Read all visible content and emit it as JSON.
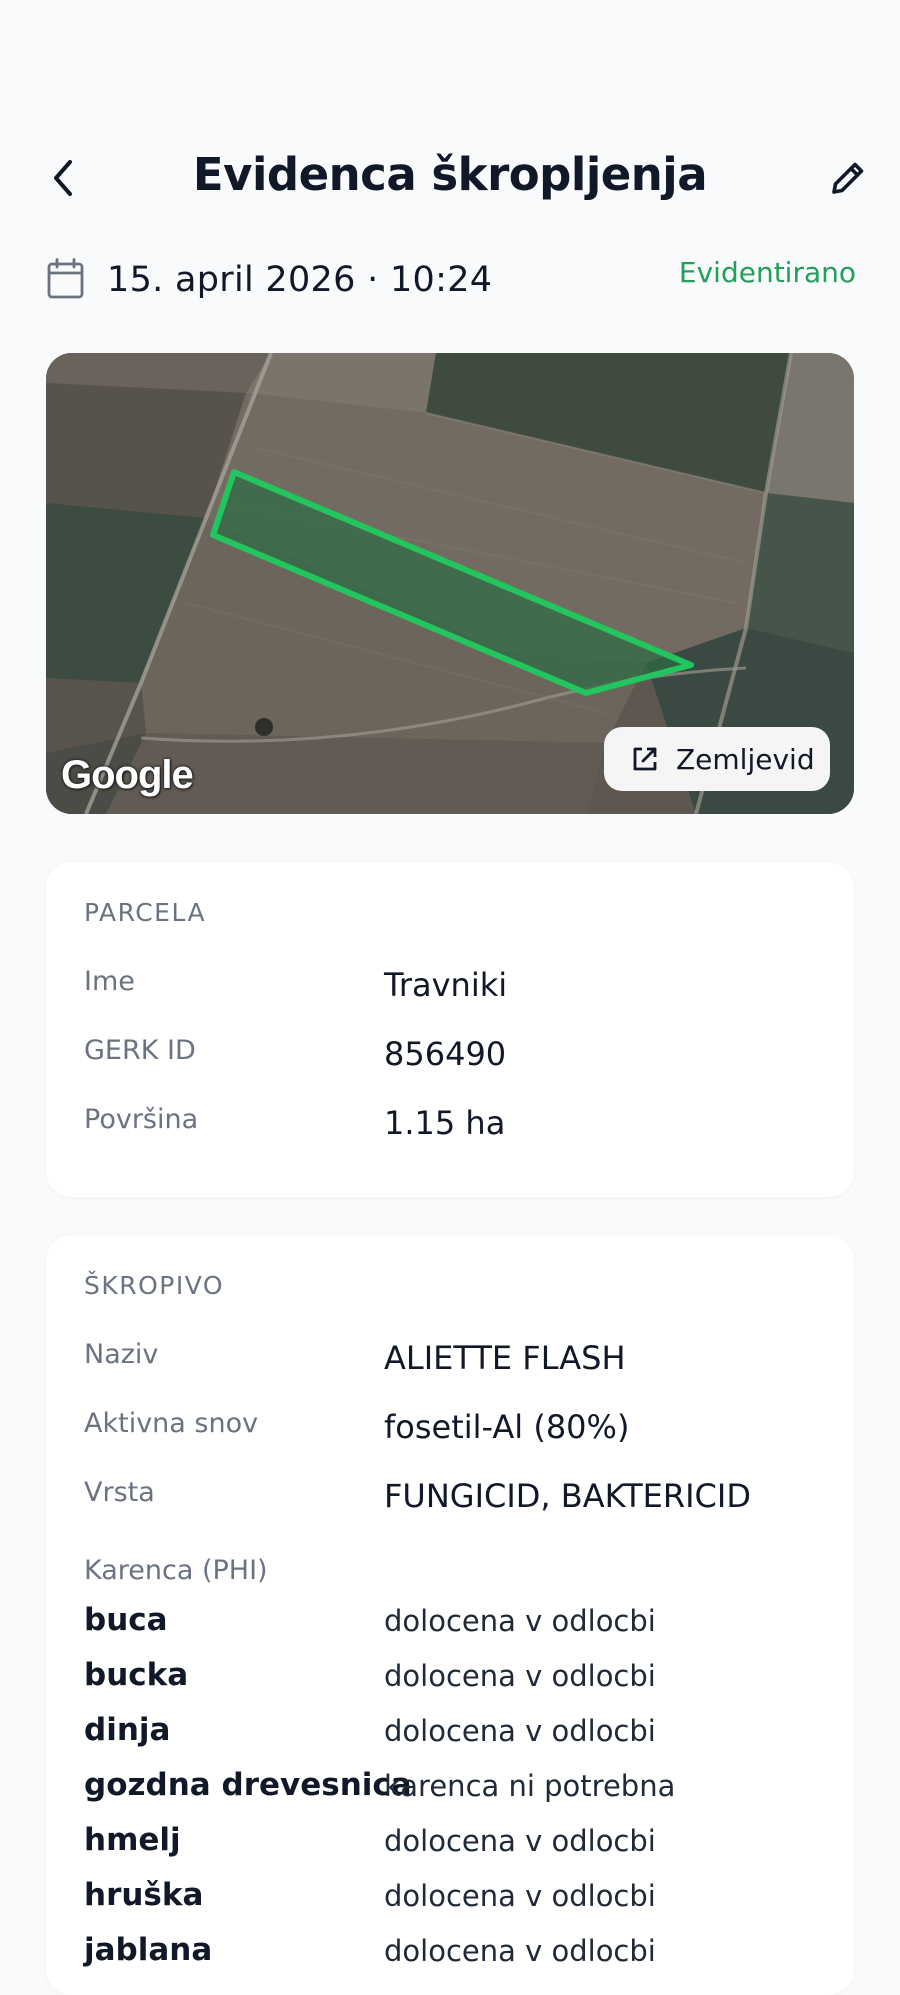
{
  "header": {
    "title": "Evidenca škropljenja",
    "back_icon": "chevron-left-icon",
    "edit_icon": "pencil-icon"
  },
  "meta": {
    "date": "15. april 2026 · 10:24",
    "status": "Evidentirano",
    "status_color": "#22a05a"
  },
  "map": {
    "attribution": "Google",
    "button_label": "Zemljevid",
    "button_icon": "external-link-icon",
    "highlight_color": "#22c55e"
  },
  "parcela": {
    "section_title": "PARCELA",
    "rows": [
      {
        "label": "Ime",
        "value": "Travniki"
      },
      {
        "label": "GERK ID",
        "value": "856490"
      },
      {
        "label": "Površina",
        "value": "1.15 ha"
      }
    ]
  },
  "skropivo": {
    "section_title": "ŠKROPIVO",
    "rows": [
      {
        "label": "Naziv",
        "value": "ALIETTE FLASH"
      },
      {
        "label": "Aktivna snov",
        "value": "fosetil-Al (80%)"
      },
      {
        "label": "Vrsta",
        "value": "FUNGICID, BAKTERICID"
      }
    ],
    "phi_label": "Karenca (PHI)",
    "phi_rows": [
      {
        "crop": "buca",
        "value": "dolocena v odlocbi"
      },
      {
        "crop": "bucka",
        "value": "dolocena v odlocbi"
      },
      {
        "crop": "dinja",
        "value": "dolocena v odlocbi"
      },
      {
        "crop": "gozdna drevesnica",
        "value": "karenca ni potrebna"
      },
      {
        "crop": "hmelj",
        "value": "dolocena v odlocbi"
      },
      {
        "crop": "hruška",
        "value": "dolocena v odlocbi"
      },
      {
        "crop": "jablana",
        "value": "dolocena v odlocbi"
      }
    ]
  }
}
